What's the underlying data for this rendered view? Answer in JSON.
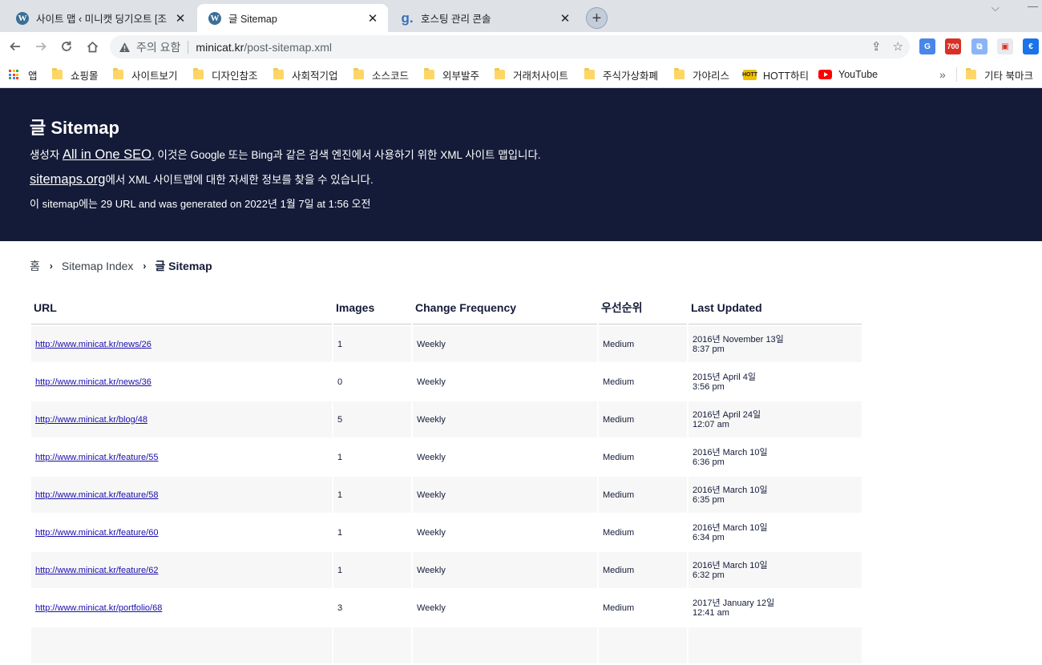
{
  "tabs": [
    {
      "title": "사이트 맵 ‹ 미니캣 딩기오트 [조",
      "favicon": "wordpress-icon",
      "active": false
    },
    {
      "title": "글 Sitemap",
      "favicon": "wordpress-icon",
      "active": true
    },
    {
      "title": "호스팅 관리 콘솔",
      "favicon": "gabia-icon",
      "active": false
    }
  ],
  "toolbar": {
    "security_label": "주의 요함",
    "url_host": "minicat.kr",
    "url_path": "/post-sitemap.xml",
    "gmail_count": "700"
  },
  "bookmarks": {
    "apps": "앱",
    "items": [
      "쇼핑몰",
      "사이트보기",
      "디자인참조",
      "사회적기업",
      "소스코드",
      "외부발주",
      "거래처사이트",
      "주식가상화폐",
      "가야리스"
    ],
    "hott": "HOTT하티",
    "hott_logo": "HOTT",
    "youtube": "YouTube",
    "more": "»",
    "other": "기타 북마크"
  },
  "header": {
    "title": "글 Sitemap",
    "line1_prefix": "생성자 ",
    "line1_link": "All in One SEO",
    "line1_suffix": ", 이것은 Google 또는 Bing과 같은 검색 엔진에서 사용하기 위한 XML 사이트 맵입니다.",
    "line2_link": "sitemaps.org",
    "line2_suffix": "에서 XML 사이트맵에 대한 자세한 정보를 찾을 수 있습니다.",
    "line3": "이 sitemap에는 29 URL and was generated on 2022년 1월 7일 at 1:56 오전"
  },
  "breadcrumb": {
    "home": "홈",
    "index": "Sitemap Index",
    "current": "글 Sitemap"
  },
  "table": {
    "headers": {
      "url": "URL",
      "images": "Images",
      "freq": "Change Frequency",
      "priority": "우선순위",
      "updated": "Last Updated"
    },
    "rows": [
      {
        "url": "http://www.minicat.kr/news/26",
        "images": "1",
        "freq": "Weekly",
        "priority": "Medium",
        "date": "2016년 November 13일",
        "time": "8:37 pm"
      },
      {
        "url": "http://www.minicat.kr/news/36",
        "images": "0",
        "freq": "Weekly",
        "priority": "Medium",
        "date": "2015년 April 4일",
        "time": "3:56 pm"
      },
      {
        "url": "http://www.minicat.kr/blog/48",
        "images": "5",
        "freq": "Weekly",
        "priority": "Medium",
        "date": "2016년 April 24일",
        "time": "12:07 am"
      },
      {
        "url": "http://www.minicat.kr/feature/55",
        "images": "1",
        "freq": "Weekly",
        "priority": "Medium",
        "date": "2016년 March 10일",
        "time": "6:36 pm"
      },
      {
        "url": "http://www.minicat.kr/feature/58",
        "images": "1",
        "freq": "Weekly",
        "priority": "Medium",
        "date": "2016년 March 10일",
        "time": "6:35 pm"
      },
      {
        "url": "http://www.minicat.kr/feature/60",
        "images": "1",
        "freq": "Weekly",
        "priority": "Medium",
        "date": "2016년 March 10일",
        "time": "6:34 pm"
      },
      {
        "url": "http://www.minicat.kr/feature/62",
        "images": "1",
        "freq": "Weekly",
        "priority": "Medium",
        "date": "2016년 March 10일",
        "time": "6:32 pm"
      },
      {
        "url": "http://www.minicat.kr/portfolio/68",
        "images": "3",
        "freq": "Weekly",
        "priority": "Medium",
        "date": "2017년 January 12일",
        "time": "12:41 am"
      },
      {
        "url": "",
        "images": "",
        "freq": "",
        "priority": "",
        "date": "",
        "time": ""
      }
    ]
  },
  "colors": {
    "header_bg": "#141b38",
    "link": "#1a0dab",
    "row_alt": "#f7f7f7",
    "tabstrip": "#dee1e6"
  }
}
